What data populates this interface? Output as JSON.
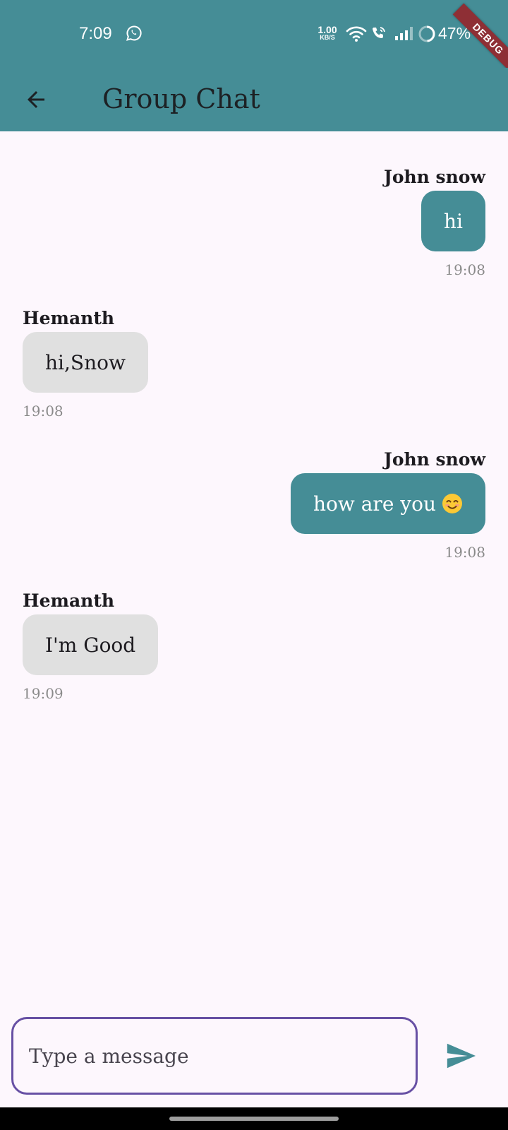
{
  "status_bar": {
    "time": "7:09",
    "net_speed_value": "1.00",
    "net_speed_unit": "KB/S",
    "battery_percent": "47%",
    "icons": [
      "whatsapp-icon",
      "wifi-icon",
      "wifi-call-icon",
      "signal-icon",
      "battery-icon"
    ]
  },
  "debug_banner": "DEBUG",
  "app_bar": {
    "title": "Group Chat",
    "back_icon": "arrow-back-icon"
  },
  "messages": [
    {
      "sender": "John snow",
      "text": "hi",
      "time": "19:08",
      "direction": "outgoing"
    },
    {
      "sender": "Hemanth",
      "text": "hi,Snow",
      "time": "19:08",
      "direction": "incoming"
    },
    {
      "sender": "John snow",
      "text": "how are you",
      "emoji": "smiling-face-emoji",
      "time": "19:08",
      "direction": "outgoing"
    },
    {
      "sender": "Hemanth",
      "text": "I'm Good",
      "time": "19:09",
      "direction": "incoming"
    }
  ],
  "composer": {
    "placeholder": "Type a message",
    "value": "",
    "send_icon": "send-icon"
  },
  "colors": {
    "primary": "#458d96",
    "background": "#fdf7fd",
    "incoming_bubble": "#e0e0e0",
    "input_border": "#6750a4",
    "debug": "#8e2f35",
    "timestamp": "#8a8a8a"
  }
}
